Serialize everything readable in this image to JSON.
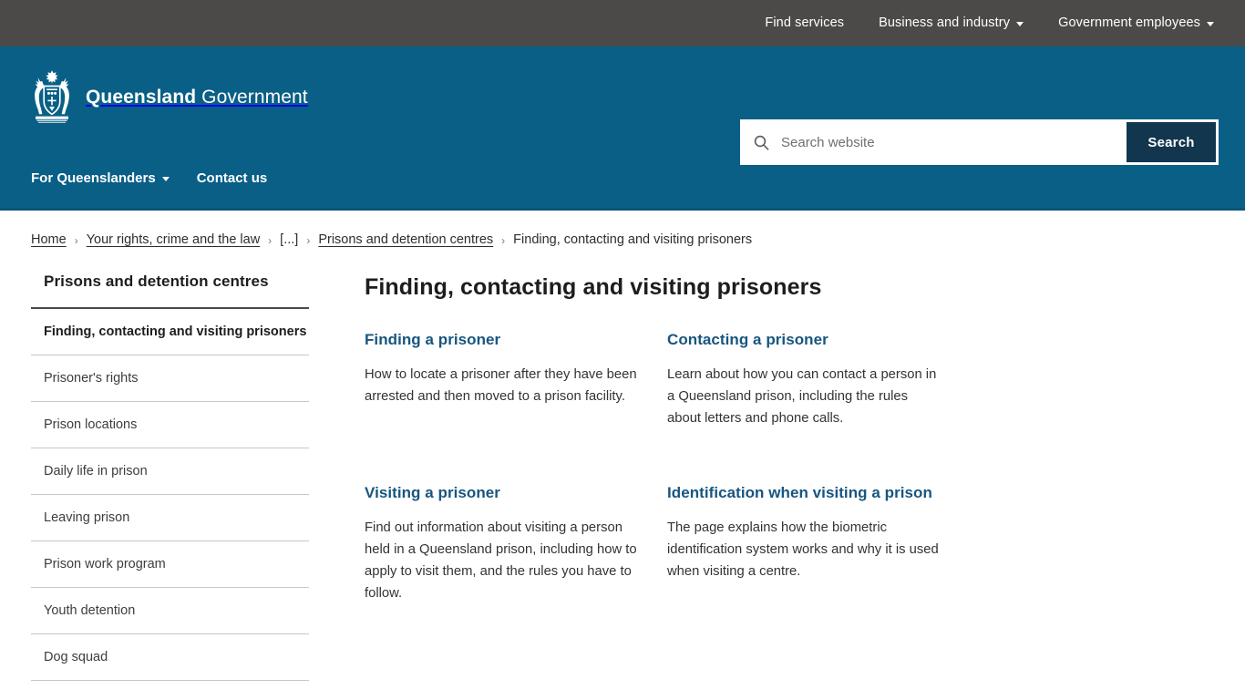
{
  "utility_nav": {
    "items": [
      {
        "label": "Find services",
        "has_dropdown": false
      },
      {
        "label": "Business and industry",
        "has_dropdown": true
      },
      {
        "label": "Government employees",
        "has_dropdown": true
      }
    ]
  },
  "brand": {
    "name_bold": "Queensland",
    "name_light": "Government",
    "crest_alt": "queensland-coat-of-arms"
  },
  "search": {
    "placeholder": "Search website",
    "value": "",
    "button_label": "Search"
  },
  "secondary_nav": {
    "items": [
      {
        "label": "For Queenslanders",
        "has_dropdown": true
      },
      {
        "label": "Contact us",
        "has_dropdown": false
      }
    ]
  },
  "breadcrumb": {
    "separator": "›",
    "items": [
      {
        "label": "Home",
        "link": true
      },
      {
        "label": "Your rights, crime and the law",
        "link": true
      },
      {
        "label": "[...]",
        "link": false
      },
      {
        "label": "Prisons and detention centres",
        "link": true
      },
      {
        "label": "Finding, contacting and visiting prisoners",
        "link": false
      }
    ]
  },
  "sidebar": {
    "title": "Prisons and detention centres",
    "items": [
      {
        "label": "Finding, contacting and visiting prisoners",
        "active": true
      },
      {
        "label": "Prisoner's rights",
        "active": false
      },
      {
        "label": "Prison locations",
        "active": false
      },
      {
        "label": "Daily life in prison",
        "active": false
      },
      {
        "label": "Leaving prison",
        "active": false
      },
      {
        "label": "Prison work program",
        "active": false
      },
      {
        "label": "Youth detention",
        "active": false
      },
      {
        "label": "Dog squad",
        "active": false
      }
    ]
  },
  "main": {
    "title": "Finding, contacting and visiting prisoners",
    "cards": [
      {
        "title": "Finding a prisoner",
        "description": "How to locate a prisoner after they have been arrested and then moved to a prison facility."
      },
      {
        "title": "Contacting a prisoner",
        "description": "Learn about how you can contact a person in a Queensland prison, including the rules about letters and phone calls."
      },
      {
        "title": "Visiting a prisoner",
        "description": "Find out information about visiting a person held in a Queensland prison, including how to apply to visit them, and the rules you have to follow."
      },
      {
        "title": "Identification when visiting a prison",
        "description": "The page explains how the biometric identification system works and why it is used when visiting a centre."
      }
    ]
  },
  "colors": {
    "utility_bar": "#4b4a48",
    "brand_blue": "#095f86",
    "search_button": "#12364e",
    "link_blue": "#17567f",
    "text_dark": "#1d1d1d"
  }
}
